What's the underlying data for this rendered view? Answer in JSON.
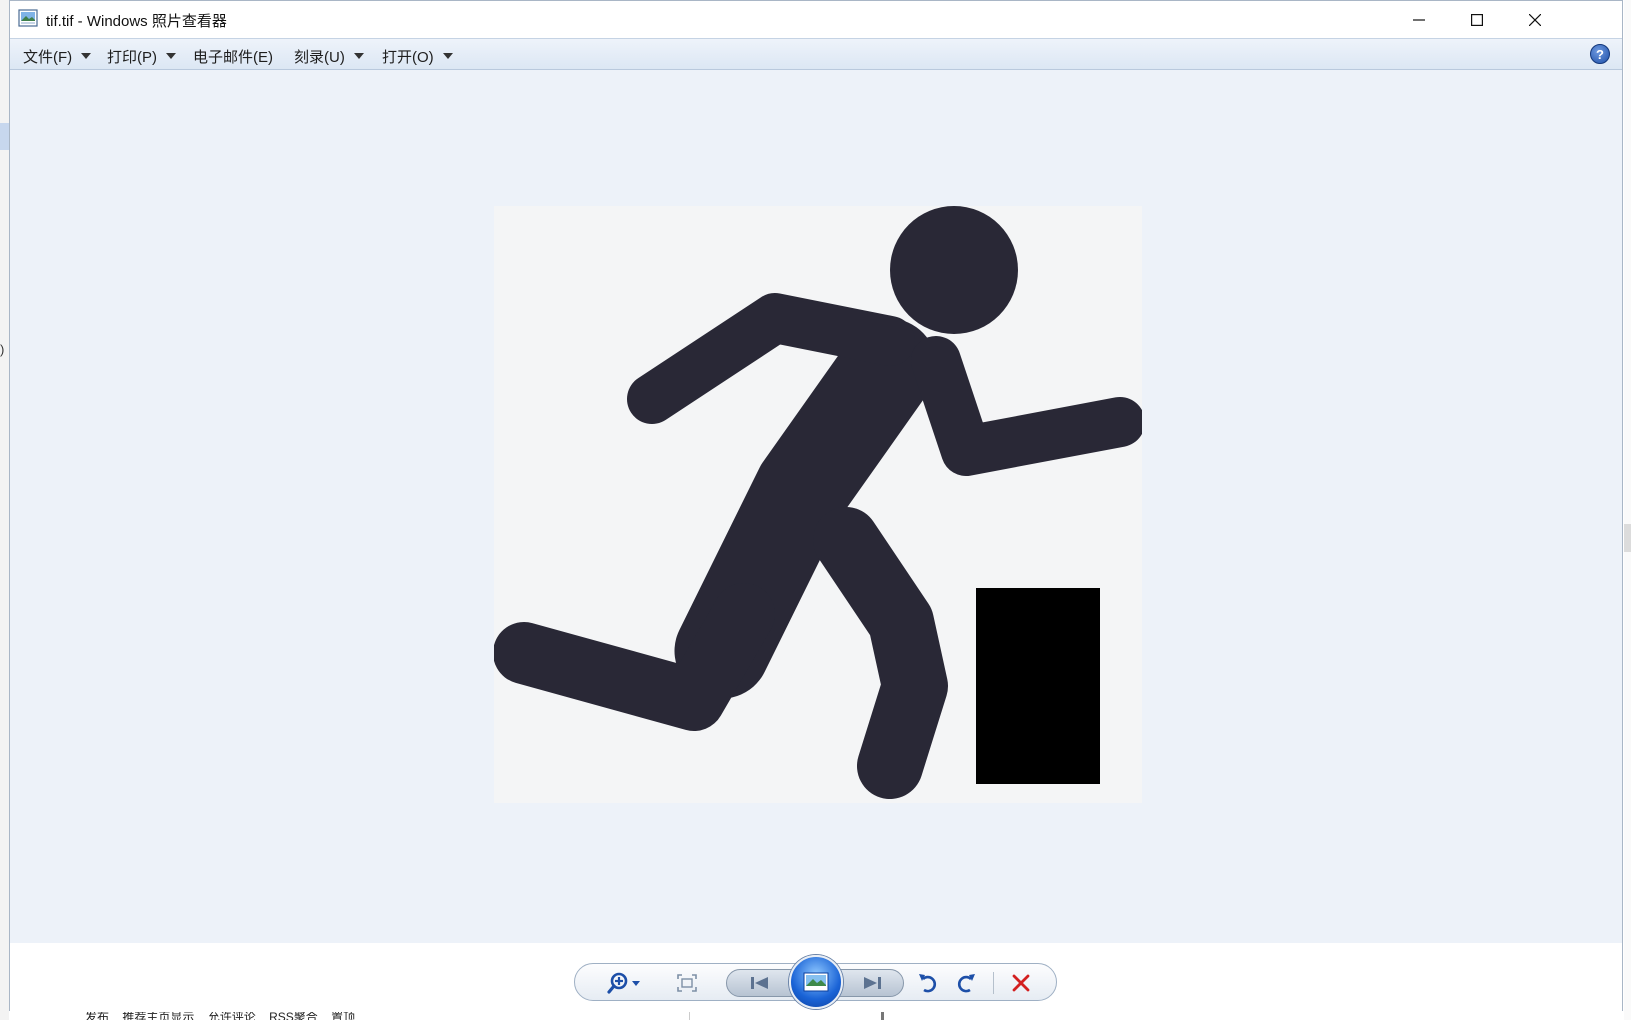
{
  "window": {
    "title": "tif.tif - Windows 照片查看器",
    "controls": {
      "minimize": "minimize-icon",
      "maximize": "maximize-icon",
      "close": "close-icon"
    }
  },
  "menu": [
    {
      "label": "文件(F)",
      "has_dropdown": true
    },
    {
      "label": "打印(P)",
      "has_dropdown": true
    },
    {
      "label": "电子邮件(E)",
      "has_dropdown": false
    },
    {
      "label": "刻录(U)",
      "has_dropdown": true
    },
    {
      "label": "打开(O)",
      "has_dropdown": true
    }
  ],
  "help_label": "?",
  "image": {
    "subject": "running stick figure pictogram with black rectangle",
    "figure_color": "#292836",
    "block_color": "#000000",
    "background_color": "#f4f5f6"
  },
  "toolbar": {
    "buttons": [
      "zoom-icon",
      "actual-size-icon",
      "previous-icon",
      "slideshow-icon",
      "next-icon",
      "rotate-counterclockwise-icon",
      "rotate-clockwise-icon",
      "delete-icon"
    ]
  },
  "background_app": {
    "bottom_options": [
      "发布",
      "推荐主页显示",
      "允许评论",
      "RSS聚合",
      "置顶"
    ]
  },
  "colors": {
    "viewport_bg": "#edf2f9",
    "menubar_bg": "#dce7f4",
    "accent_blue": "#1a63d6",
    "delete_red": "#d32020"
  }
}
